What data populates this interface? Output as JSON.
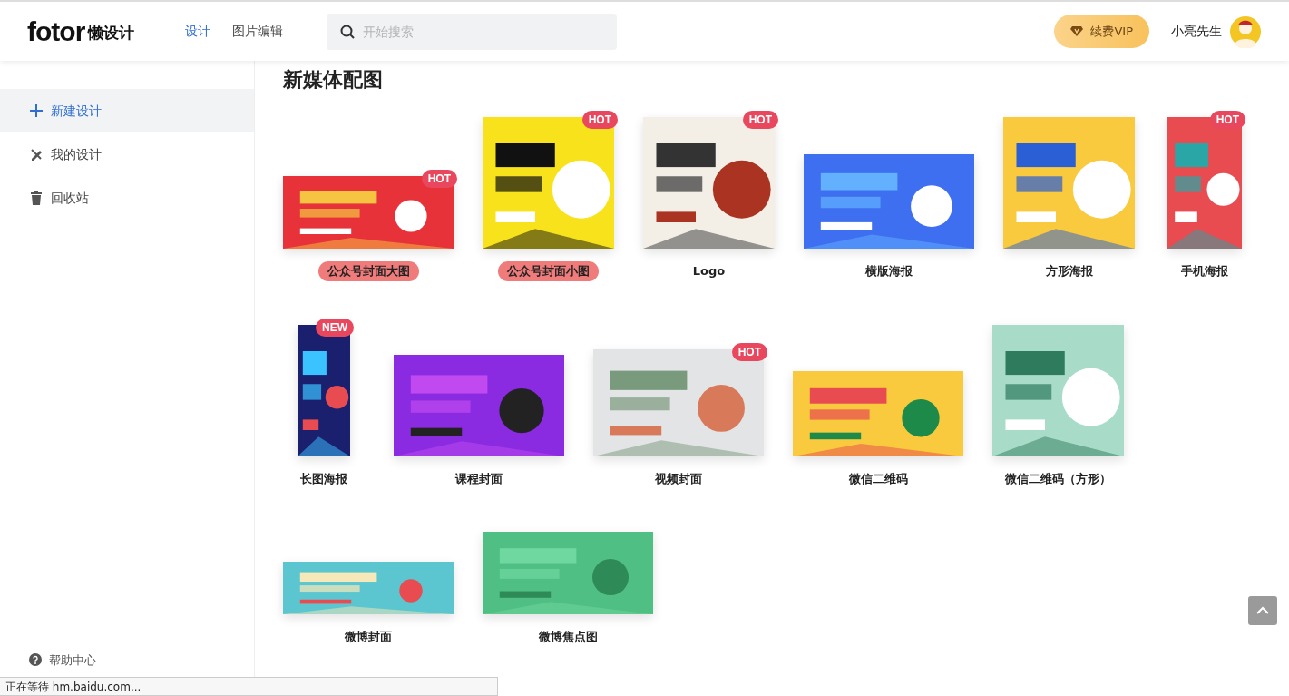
{
  "header": {
    "logo": "fotor",
    "logo_suffix": "懒设计",
    "nav": [
      {
        "label": "设计",
        "selected": true
      },
      {
        "label": "图片编辑",
        "selected": false
      }
    ],
    "search": {
      "placeholder": "开始搜索"
    },
    "vip_button": "续费VIP",
    "user_name": "小亮先生"
  },
  "sidebar": {
    "items": [
      {
        "label": "新建设计",
        "selected": true
      },
      {
        "label": "我的设计",
        "selected": false
      },
      {
        "label": "回收站",
        "selected": false
      }
    ],
    "help": "帮助中心"
  },
  "section_title": "新媒体配图",
  "templates": [
    {
      "label": "公众号封面大图",
      "kind": "banner",
      "badge": "HOT",
      "highlighted": true
    },
    {
      "label": "公众号封面小图",
      "kind": "square",
      "badge": "HOT",
      "highlighted": true
    },
    {
      "label": "Logo",
      "kind": "square",
      "badge": "HOT",
      "highlighted": false
    },
    {
      "label": "横版海报",
      "kind": "landscape",
      "highlighted": false
    },
    {
      "label": "方形海报",
      "kind": "square",
      "highlighted": false
    },
    {
      "label": "手机海报",
      "kind": "phone",
      "badge": "HOT",
      "highlighted": false
    },
    {
      "label": "长图海报",
      "kind": "long",
      "badge": "NEW",
      "highlighted": false
    },
    {
      "label": "课程封面",
      "kind": "course",
      "highlighted": false
    },
    {
      "label": "视频封面",
      "kind": "video",
      "badge": "HOT",
      "highlighted": false
    },
    {
      "label": "微信二维码",
      "kind": "qr",
      "highlighted": false
    },
    {
      "label": "微信二维码（方形）",
      "kind": "square",
      "highlighted": false
    },
    {
      "label": "微博封面",
      "kind": "strip",
      "highlighted": false
    },
    {
      "label": "微博焦点图",
      "kind": "focus",
      "highlighted": false
    }
  ],
  "status_bar": "正在等待 hm.baidu.com..."
}
